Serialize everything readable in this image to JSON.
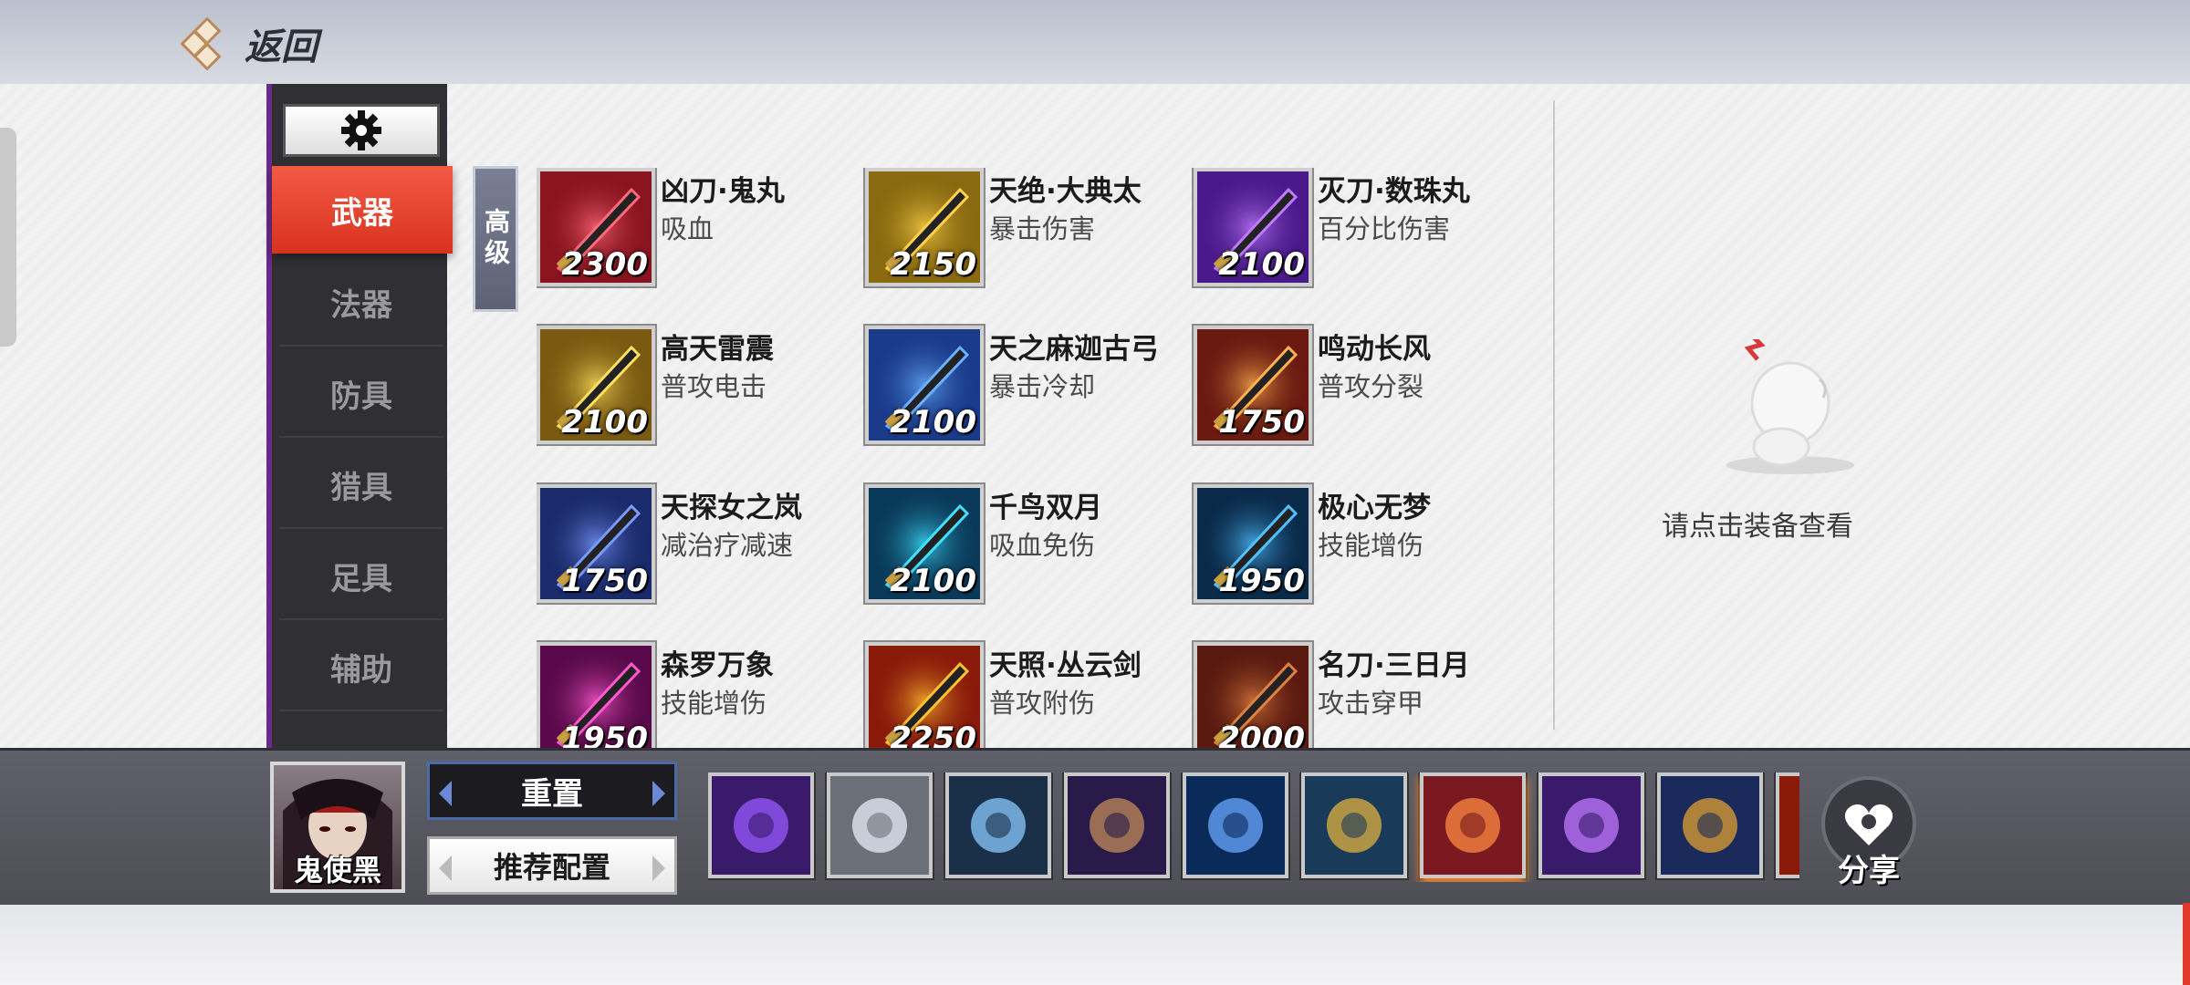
{
  "header": {
    "back_label": "返回"
  },
  "sidebar": {
    "items": [
      {
        "label": "武器",
        "active": true
      },
      {
        "label": "法器",
        "active": false
      },
      {
        "label": "防具",
        "active": false
      },
      {
        "label": "猎具",
        "active": false
      },
      {
        "label": "足具",
        "active": false
      },
      {
        "label": "辅助",
        "active": false
      }
    ]
  },
  "tier_label": "高级",
  "items": [
    {
      "name": "凶刀·鬼丸",
      "desc": "吸血",
      "price": "2300",
      "color": "#8a1420",
      "accent": "#ff6a7a"
    },
    {
      "name": "天绝·大典太",
      "desc": "暴击伤害",
      "price": "2150",
      "color": "#8a6a10",
      "accent": "#ffd24a"
    },
    {
      "name": "灭刀·数珠丸",
      "desc": "百分比伤害",
      "price": "2100",
      "color": "#4a1a8a",
      "accent": "#c07aff"
    },
    {
      "name": "高天雷震",
      "desc": "普攻电击",
      "price": "2100",
      "color": "#7a5a10",
      "accent": "#ffe060"
    },
    {
      "name": "天之麻迦古弓",
      "desc": "暴击冷却",
      "price": "2100",
      "color": "#1a3a8a",
      "accent": "#6ab0ff"
    },
    {
      "name": "鸣动长风",
      "desc": "普攻分裂",
      "price": "1750",
      "color": "#6a1a10",
      "accent": "#ffb050"
    },
    {
      "name": "天探女之岚",
      "desc": "减治疗减速",
      "price": "1750",
      "color": "#1a2a6a",
      "accent": "#7a9aff"
    },
    {
      "name": "千鸟双月",
      "desc": "吸血免伤",
      "price": "2100",
      "color": "#0a3a5a",
      "accent": "#40e0ff"
    },
    {
      "name": "极心无梦",
      "desc": "技能增伤",
      "price": "1950",
      "color": "#0a2a4a",
      "accent": "#50c0ff"
    },
    {
      "name": "森罗万象",
      "desc": "技能增伤",
      "price": "1950",
      "color": "#5a0a4a",
      "accent": "#ff5ad0"
    },
    {
      "name": "天照·丛云剑",
      "desc": "普攻附伤",
      "price": "2250",
      "color": "#8a1a0a",
      "accent": "#ffc030"
    },
    {
      "name": "名刀·三日月",
      "desc": "攻击穿甲",
      "price": "2000",
      "color": "#5a1a10",
      "accent": "#e08040"
    }
  ],
  "detail": {
    "hint": "请点击装备查看"
  },
  "hero": {
    "name": "鬼使黑"
  },
  "buttons": {
    "reset": "重置",
    "recommend": "推荐配置",
    "share": "分享"
  },
  "loadout": [
    {
      "icon": "purple-dagger-icon",
      "color": "#3a1a6a",
      "accent": "#9a5aff"
    },
    {
      "icon": "white-boots-icon",
      "color": "#6a6f78",
      "accent": "#e8eef8"
    },
    {
      "icon": "fox-mask-icon",
      "color": "#1a3048",
      "accent": "#8ac8ff"
    },
    {
      "icon": "purple-boot-icon",
      "color": "#2a1a4a",
      "accent": "#c08a5a"
    },
    {
      "icon": "blue-armor-icon",
      "color": "#0a2a5a",
      "accent": "#6aa8ff"
    },
    {
      "icon": "gold-mirror-icon",
      "color": "#1a3a5a",
      "accent": "#e0b040"
    },
    {
      "icon": "red-hammer-icon",
      "color": "#7a1a20",
      "accent": "#ff8a40",
      "selected": true
    },
    {
      "icon": "purple-blade-icon",
      "color": "#3a1a6a",
      "accent": "#c07aff"
    },
    {
      "icon": "gold-crown-icon",
      "color": "#1a2a5a",
      "accent": "#e0a030"
    },
    {
      "icon": "red-partial-icon",
      "color": "#8a1a0a",
      "accent": "#ff6a2a"
    }
  ]
}
